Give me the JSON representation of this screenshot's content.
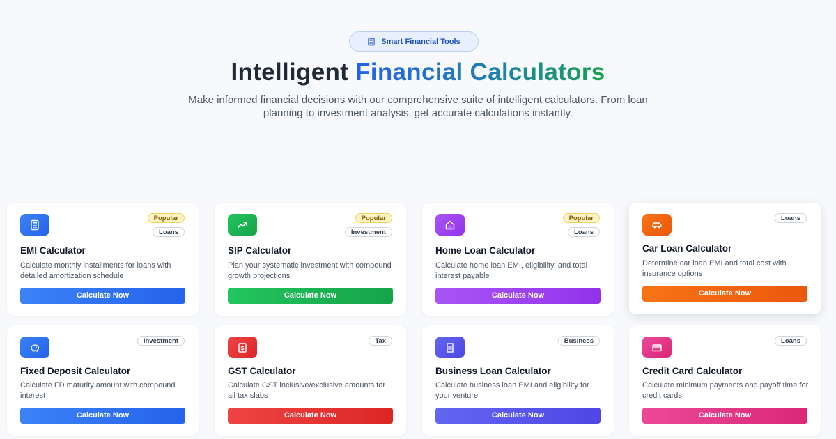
{
  "header": {
    "pill_label": "Smart Financial Tools",
    "title_part1": "Intelligent",
    "title_part2": "Financial Calculators",
    "subtitle": "Make informed financial decisions with our comprehensive suite of intelligent calculators. From loan planning to investment analysis, get accurate calculations instantly."
  },
  "cards": [
    {
      "title": "EMI Calculator",
      "description": "Calculate monthly installments for loans with detailed amortization schedule",
      "badge_popular": "Popular",
      "badge_category": "Loans",
      "button": "Calculate Now",
      "icon": "calculator-icon",
      "color": "#2563eb"
    },
    {
      "title": "SIP Calculator",
      "description": "Plan your systematic investment with compound growth projections",
      "badge_popular": "Popular",
      "badge_category": "Investment",
      "button": "Calculate Now",
      "icon": "trending-up-icon",
      "color": "#16a34a"
    },
    {
      "title": "Home Loan Calculator",
      "description": "Calculate home loan EMI, eligibility, and total interest payable",
      "badge_popular": "Popular",
      "badge_category": "Loans",
      "button": "Calculate Now",
      "icon": "home-icon",
      "color": "#9333ea"
    },
    {
      "title": "Car Loan Calculator",
      "description": "Determine car loan EMI and total cost with insurance options",
      "badge_category": "Loans",
      "button": "Calculate Now",
      "icon": "car-icon",
      "color": "#ea580c"
    },
    {
      "title": "Fixed Deposit Calculator",
      "description": "Calculate FD maturity amount with compound interest",
      "badge_category": "Investment",
      "button": "Calculate Now",
      "icon": "piggy-bank-icon",
      "color": "#2563eb"
    },
    {
      "title": "GST Calculator",
      "description": "Calculate GST inclusive/exclusive amounts for all tax slabs",
      "badge_category": "Tax",
      "button": "Calculate Now",
      "icon": "receipt-icon",
      "color": "#dc2626"
    },
    {
      "title": "Business Loan Calculator",
      "description": "Calculate business loan EMI and eligibility for your venture",
      "badge_category": "Business",
      "button": "Calculate Now",
      "icon": "building-icon",
      "color": "#4f46e5"
    },
    {
      "title": "Credit Card Calculator",
      "description": "Calculate minimum payments and payoff time for credit cards",
      "badge_category": "Loans",
      "button": "Calculate Now",
      "icon": "credit-card-icon",
      "color": "#db2777"
    }
  ]
}
